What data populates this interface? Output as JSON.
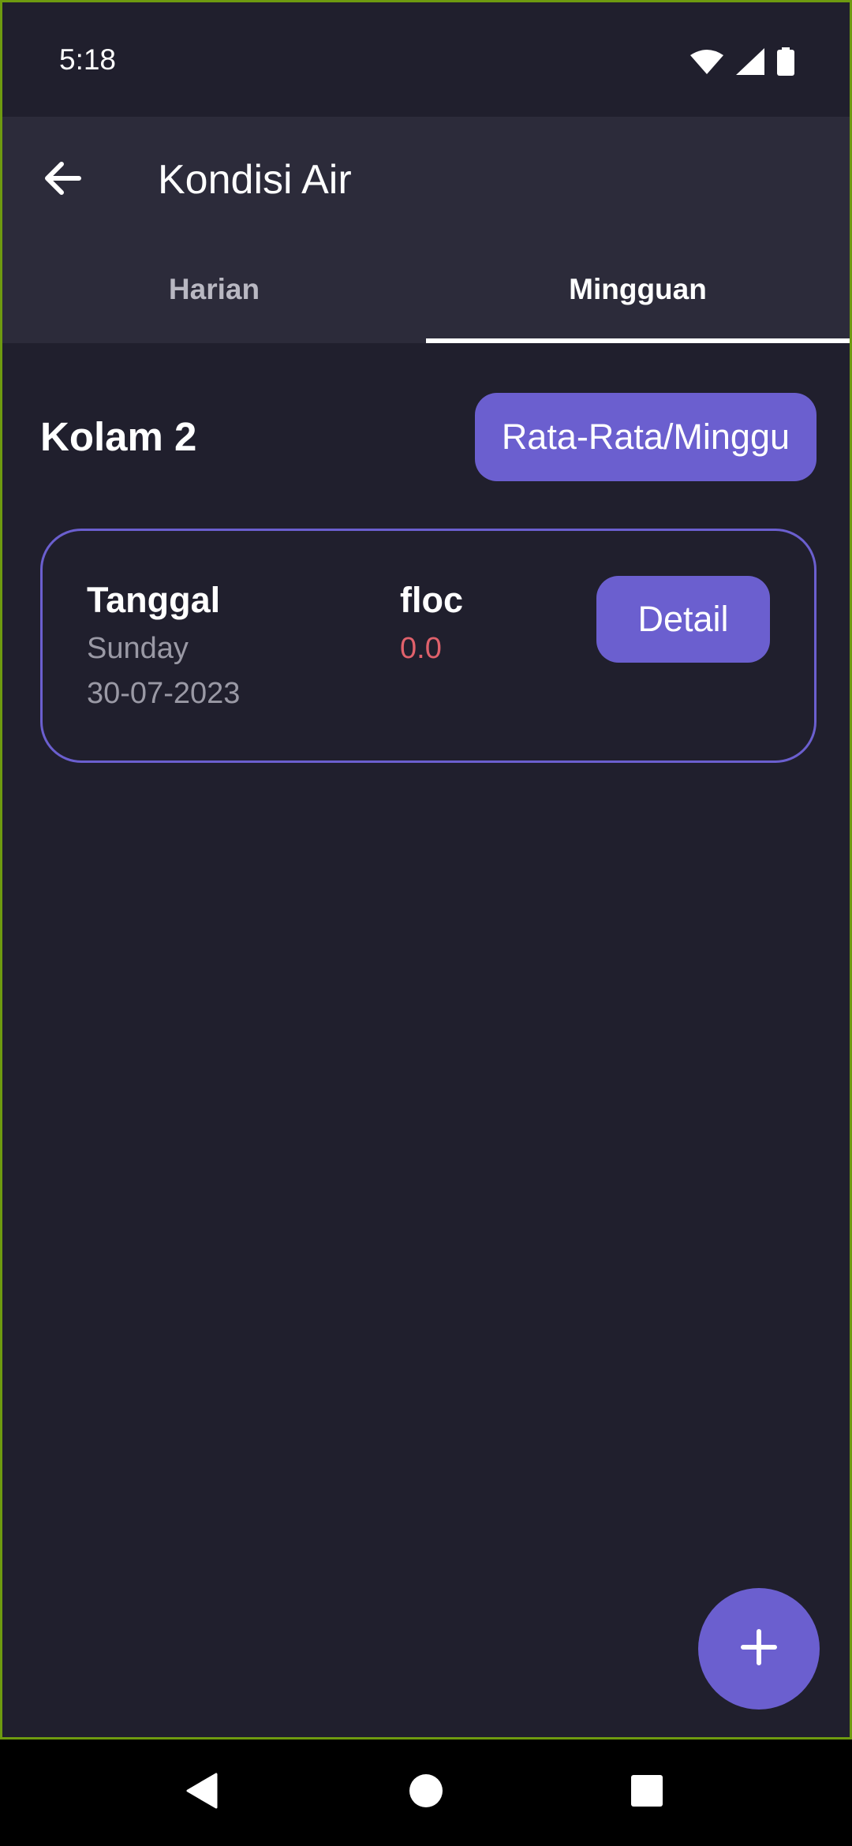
{
  "status_bar": {
    "time": "5:18",
    "icons": [
      "wifi-icon",
      "cellular-signal-icon",
      "battery-icon"
    ]
  },
  "app_bar": {
    "title": "Kondisi Air",
    "back_icon": "arrow-left-icon"
  },
  "tabs": [
    {
      "label": "Harian",
      "selected": false
    },
    {
      "label": "Mingguan",
      "selected": true
    }
  ],
  "section": {
    "pond_name": "Kolam 2",
    "average_button_label": "Rata-Rata/Minggu"
  },
  "records": [
    {
      "date_label": "Tanggal",
      "day": "Sunday",
      "date": "30-07-2023",
      "param_label": "floc",
      "param_value": "0.0",
      "detail_label": "Detail"
    }
  ],
  "fab": {
    "icon": "plus-icon"
  },
  "nav_bar": {
    "icons": [
      "back-triangle-icon",
      "home-circle-icon",
      "recents-square-icon"
    ]
  },
  "colors": {
    "background": "#201f2d",
    "app_bar": "#2c2b3a",
    "accent": "#6b5fcf",
    "value_red": "#e0616b",
    "muted_text": "#9a99a5",
    "frame_border": "#6e9a10"
  }
}
